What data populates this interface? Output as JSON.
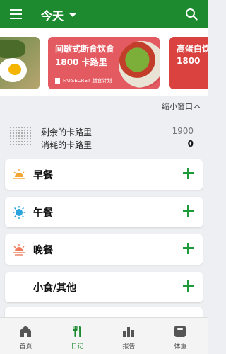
{
  "header": {
    "title": "今天"
  },
  "carousel": {
    "cards": [
      {
        "title": "间歇式断食饮食",
        "subtitle": "1800 卡路里",
        "footer": "FATSECRET 膳食计划"
      },
      {
        "title": "高蛋白饮食",
        "subtitle": "1800"
      }
    ]
  },
  "collapse_label": "缩小窗口",
  "summary": {
    "remaining_label": "剩余的卡路里",
    "remaining_value": "1900",
    "consumed_label": "消耗的卡路里",
    "consumed_value": "0"
  },
  "meals": [
    {
      "label": "早餐",
      "icon": "sunrise-icon"
    },
    {
      "label": "午餐",
      "icon": "sun-icon"
    },
    {
      "label": "晚餐",
      "icon": "sunset-icon"
    },
    {
      "label": "小食/其他",
      "icon": "moon-icon"
    }
  ],
  "bottom_nav": {
    "items": [
      {
        "label": "首页",
        "icon": "home-icon"
      },
      {
        "label": "日记",
        "icon": "cutlery-icon"
      },
      {
        "label": "报告",
        "icon": "bar-chart-icon"
      },
      {
        "label": "体重",
        "icon": "scale-icon"
      }
    ],
    "active_color": "#1d8a2f"
  },
  "colors": {
    "appbar": "#1d8a2f",
    "plus": "#1d9a3a",
    "card_main": "#e45a61"
  }
}
